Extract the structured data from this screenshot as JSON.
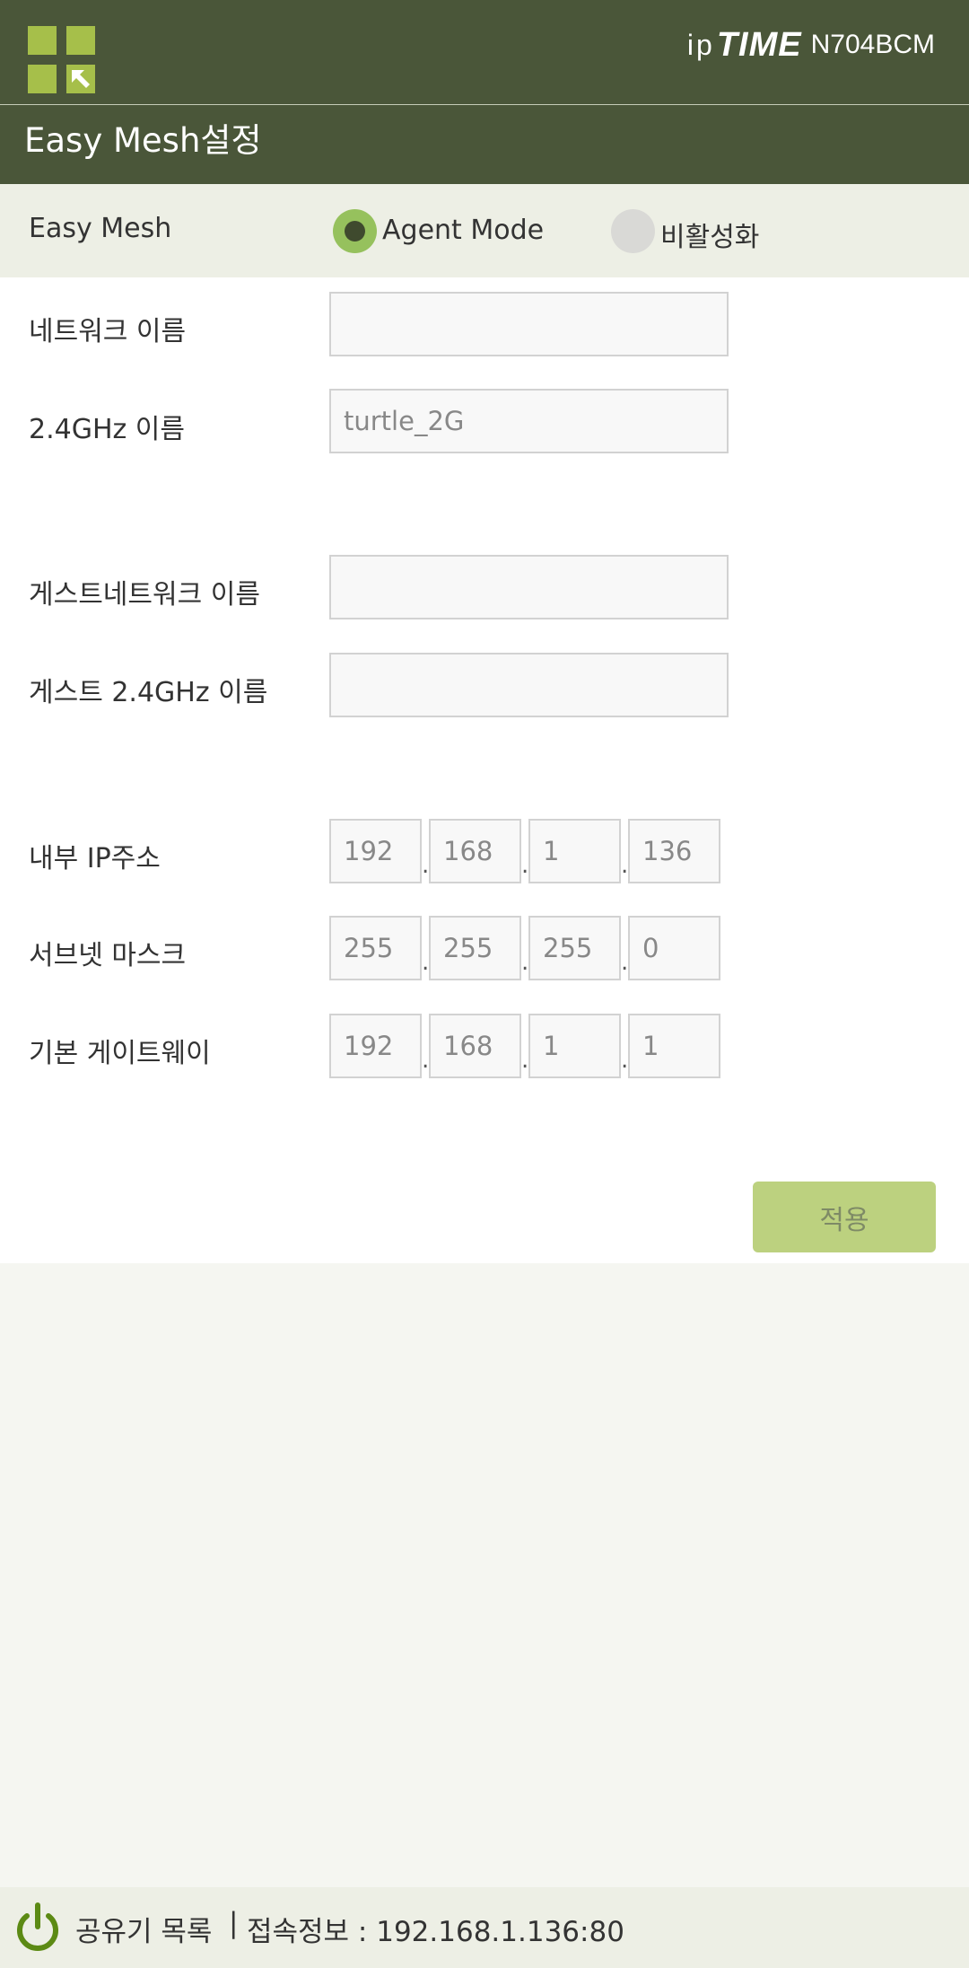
{
  "header": {
    "brand_ip": "ip",
    "brand_time": "TIME",
    "model": "N704BCM"
  },
  "page": {
    "title": "Easy Mesh설정"
  },
  "easy_mesh": {
    "label": "Easy Mesh",
    "options": [
      "Agent Mode",
      "비활성화"
    ],
    "selected": "Agent Mode"
  },
  "form": {
    "network_name": {
      "label": "네트워크 이름",
      "value": ""
    },
    "name_24g": {
      "label": "2.4GHz 이름",
      "value": "turtle_2G"
    },
    "guest_network_name": {
      "label": "게스트네트워크 이름",
      "value": ""
    },
    "guest_name_24g": {
      "label": "게스트 2.4GHz 이름",
      "value": ""
    },
    "internal_ip": {
      "label": "내부 IP주소",
      "octets": [
        "192",
        "168",
        "1",
        "136"
      ]
    },
    "subnet_mask": {
      "label": "서브넷 마스크",
      "octets": [
        "255",
        "255",
        "255",
        "0"
      ]
    },
    "gateway": {
      "label": "기본 게이트웨이",
      "octets": [
        "192",
        "168",
        "1",
        "1"
      ]
    }
  },
  "apply_label": "적용",
  "footer": {
    "router_list": "공유기 목록",
    "separator": "|",
    "conn_info": "접속정보 : 192.168.1.136:80"
  },
  "colors": {
    "header_bg": "#4a5639",
    "accent_green": "#a6bf4a",
    "radio_on": "#96c15d",
    "apply_bg": "#bcd17f",
    "row_bg": "#edefe5"
  }
}
